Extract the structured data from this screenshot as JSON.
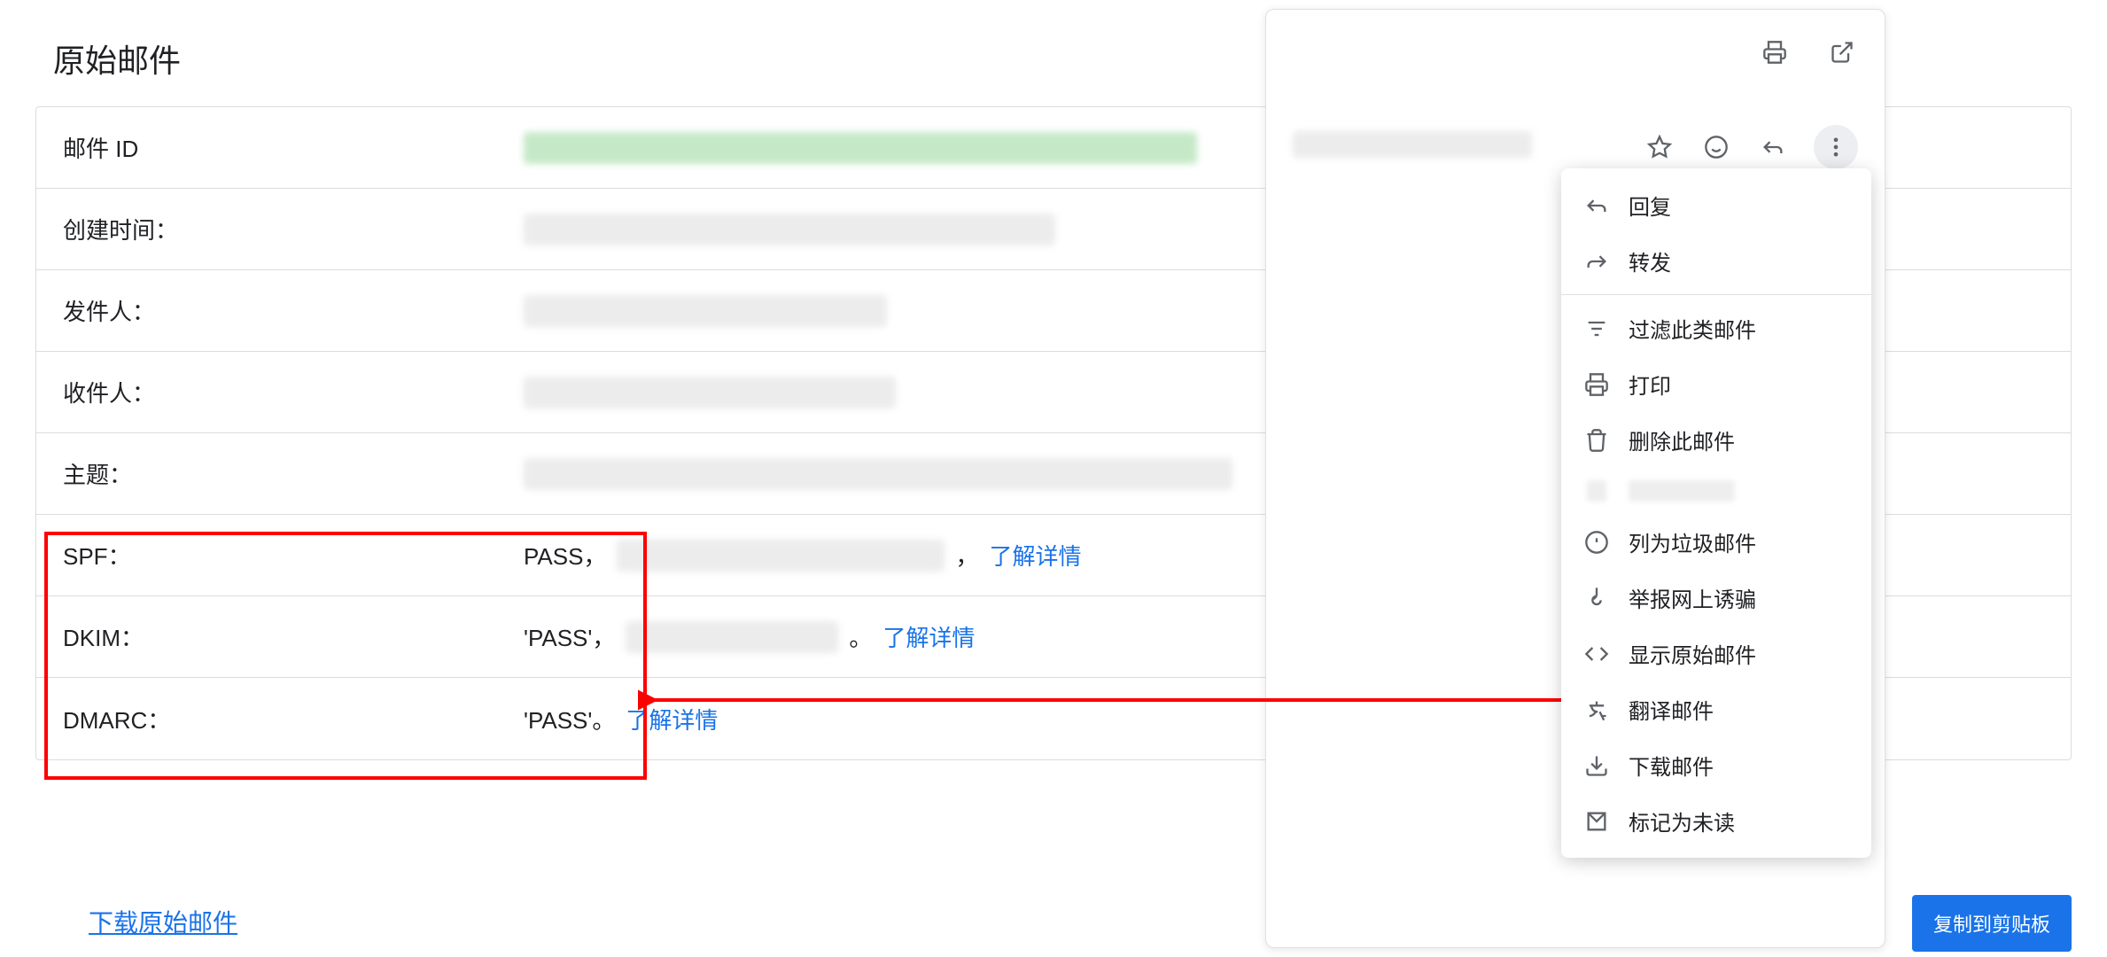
{
  "page_title": "原始邮件",
  "table": {
    "rows": [
      {
        "label": "邮件 ID",
        "value_status": "",
        "link": ""
      },
      {
        "label": "创建时间：",
        "value_status": "",
        "link": ""
      },
      {
        "label": "发件人：",
        "value_status": "",
        "link": ""
      },
      {
        "label": "收件人：",
        "value_status": "",
        "link": ""
      },
      {
        "label": "主题：",
        "value_status": "",
        "link": ""
      },
      {
        "label": "SPF：",
        "value_status": "PASS，",
        "link": "了解详情"
      },
      {
        "label": "DKIM：",
        "value_status": "'PASS'，",
        "link": "了解详情"
      },
      {
        "label": "DMARC：",
        "value_status": "'PASS'。",
        "link": "了解详情"
      }
    ]
  },
  "download_original": "下载原始邮件",
  "copy_button": "复制到剪贴板",
  "dropdown": {
    "items": [
      {
        "icon": "reply-icon",
        "label": "回复"
      },
      {
        "icon": "forward-icon",
        "label": "转发"
      },
      {
        "divider": true
      },
      {
        "icon": "filter-icon",
        "label": "过滤此类邮件"
      },
      {
        "icon": "print-icon",
        "label": "打印"
      },
      {
        "icon": "delete-icon",
        "label": "删除此邮件"
      },
      {
        "icon": "blur",
        "label": ""
      },
      {
        "icon": "spam-icon",
        "label": "列为垃圾邮件"
      },
      {
        "icon": "phishing-icon",
        "label": "举报网上诱骗"
      },
      {
        "icon": "code-icon",
        "label": "显示原始邮件"
      },
      {
        "icon": "translate-icon",
        "label": "翻译邮件"
      },
      {
        "icon": "download-icon",
        "label": "下载邮件"
      },
      {
        "icon": "mark-unread-icon",
        "label": "标记为未读"
      }
    ]
  },
  "top_icons": {
    "print": "print-icon",
    "open_external": "open-external-icon"
  },
  "row2_icons": {
    "star": "star-icon",
    "emoji": "emoji-icon",
    "reply": "reply-icon",
    "more": "more-icon"
  }
}
